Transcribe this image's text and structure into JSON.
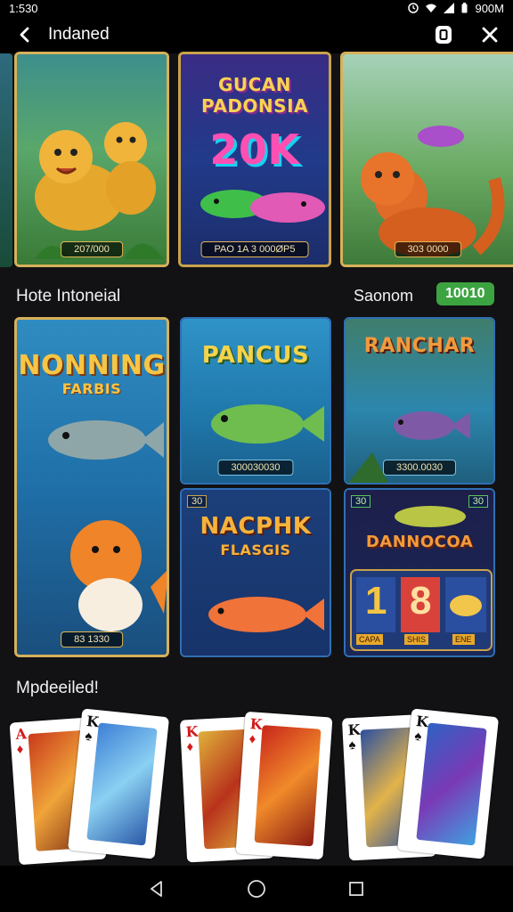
{
  "status": {
    "time": "1:530",
    "right_text": "900M"
  },
  "appbar": {
    "title": "Indaned"
  },
  "tiles_top": [
    {
      "caption": "207/000"
    },
    {
      "title": "GUCAN PADONSIA",
      "amount": "20K",
      "caption": "PAO 1A 3 000ØP5"
    },
    {
      "caption": "303 0000"
    }
  ],
  "section1": {
    "title": "Hote Intoneial",
    "right_label": "Saonom",
    "badge": "10010"
  },
  "tiles_mid": [
    {
      "title": "NONNING",
      "subtitle": "FARBIS",
      "caption": "83 1330"
    },
    {
      "title": "PANCUS",
      "caption": "300030030"
    },
    {
      "title": "RANCHAR",
      "caption": "3300.0030"
    },
    {
      "corner": "30",
      "title": "NACPHK",
      "subtitle": "FLASGIS"
    },
    {
      "corner_left": "30",
      "corner_right": "30",
      "title": "DANNOCOA",
      "reel_a": "1",
      "reel_b": "8",
      "labels": [
        "CAPA",
        "SHIS",
        "ENE"
      ]
    }
  ],
  "section2": {
    "title": "Mpdeeiled!"
  },
  "cards": [
    {
      "rank": "A",
      "suit": "♦",
      "color": "#d21b1b"
    },
    {
      "rank": "K",
      "suit": "♠",
      "color": "#111111"
    },
    {
      "rank": "K",
      "suit": "♦",
      "color": "#d21b1b"
    },
    {
      "rank": "K",
      "suit": "♦",
      "color": "#d21b1b"
    },
    {
      "rank": "K",
      "suit": "♠",
      "color": "#111111"
    },
    {
      "rank": "K",
      "suit": "♠",
      "color": "#111111"
    }
  ],
  "colors": {
    "accent_green": "#3ca341",
    "gold": "#d7b15a",
    "background": "#121214"
  }
}
